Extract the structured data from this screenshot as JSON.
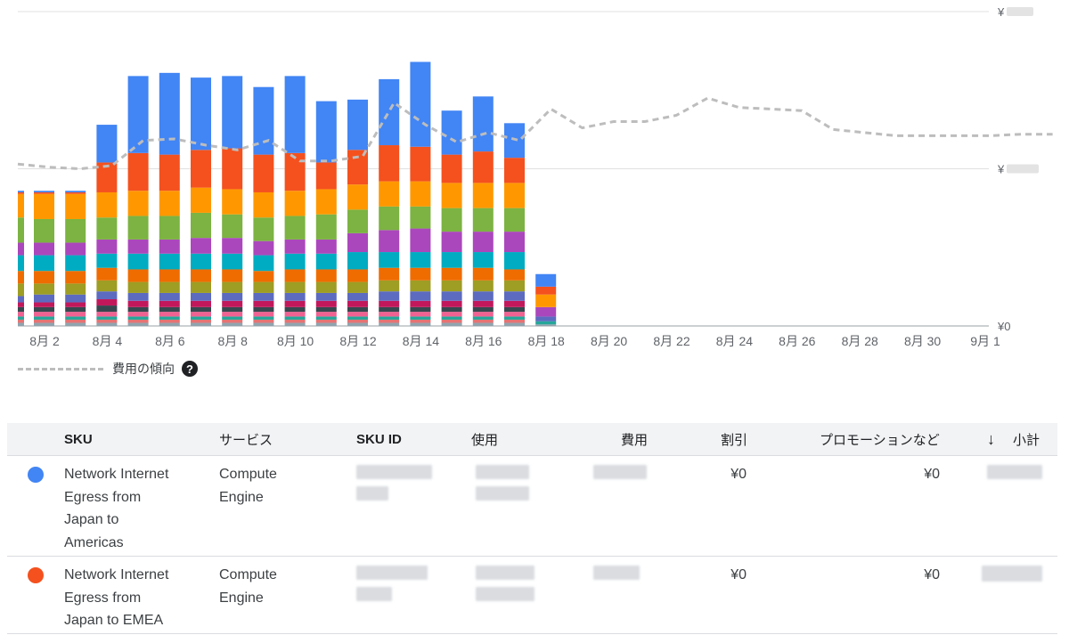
{
  "chart_data": {
    "type": "bar",
    "y_ticks": [
      "¥0"
    ],
    "x_tick_labels": [
      "8月 2",
      "8月 4",
      "8月 6",
      "8月 8",
      "8月 10",
      "8月 12",
      "8月 14",
      "8月 16",
      "8月 18",
      "8月 20",
      "8月 22",
      "8月 24",
      "8月 26",
      "8月 28",
      "8月 30",
      "9月 1"
    ],
    "days": [
      1,
      2,
      3,
      4,
      5,
      6,
      7,
      8,
      9,
      10,
      11,
      12,
      13,
      14,
      15,
      16,
      17,
      18,
      19,
      20,
      21,
      22,
      23,
      24,
      25,
      26,
      27,
      28,
      29,
      30,
      31,
      32
    ],
    "ylim": [
      0,
      200
    ],
    "series": [
      {
        "name": "Network Internet Egress from Japan to Americas",
        "color": "#4285f4",
        "values": [
          1,
          1,
          1,
          24,
          49,
          52,
          46,
          46,
          43,
          49,
          39,
          32,
          42,
          54,
          28,
          35,
          22,
          8
        ]
      },
      {
        "name": "Network Internet Egress from Japan to EMEA",
        "color": "#f4511e",
        "values": [
          1,
          1,
          1,
          19,
          24,
          23,
          24,
          26,
          24,
          24,
          17,
          22,
          23,
          22,
          18,
          20,
          16,
          5
        ]
      },
      {
        "color": "#ff9800",
        "values": [
          15,
          16,
          16,
          16,
          16,
          16,
          16,
          16,
          16,
          16,
          16,
          16,
          16,
          16,
          16,
          16,
          16,
          8
        ]
      },
      {
        "color": "#7cb342",
        "values": [
          16,
          15,
          15,
          14,
          15,
          15,
          16,
          15,
          15,
          15,
          16,
          15,
          15,
          14,
          15,
          15,
          15,
          0
        ]
      },
      {
        "color": "#ab47bc",
        "values": [
          8,
          8,
          8,
          9,
          9,
          9,
          10,
          10,
          9,
          9,
          9,
          12,
          14,
          15,
          13,
          13,
          13,
          6
        ]
      },
      {
        "color": "#00acc1",
        "values": [
          10,
          10,
          10,
          9,
          10,
          10,
          10,
          10,
          10,
          10,
          10,
          11,
          10,
          10,
          10,
          10,
          11,
          0
        ]
      },
      {
        "color": "#ef6c00",
        "values": [
          8,
          8,
          8,
          8,
          8,
          8,
          8,
          8,
          7,
          8,
          8,
          8,
          8,
          8,
          8,
          8,
          7,
          0
        ]
      },
      {
        "color": "#9e9d24",
        "values": [
          8,
          7,
          7,
          7,
          7,
          7,
          7,
          7,
          7,
          7,
          7,
          7,
          7,
          7,
          7,
          7,
          7,
          0
        ]
      },
      {
        "color": "#5c6bc0",
        "values": [
          4,
          5,
          5,
          5,
          5,
          5,
          5,
          5,
          5,
          5,
          5,
          5,
          6,
          6,
          6,
          6,
          6,
          3
        ]
      },
      {
        "color": "#c2185b",
        "values": [
          3,
          3,
          3,
          4,
          4,
          4,
          4,
          4,
          4,
          4,
          4,
          4,
          4,
          4,
          4,
          4,
          4,
          0
        ]
      },
      {
        "color": "#37474f",
        "values": [
          3,
          3,
          3,
          4,
          3,
          3,
          3,
          3,
          3,
          3,
          3,
          3,
          3,
          3,
          3,
          3,
          3,
          0
        ]
      },
      {
        "color": "#f06292",
        "values": [
          3,
          3,
          3,
          3,
          3,
          3,
          3,
          3,
          3,
          3,
          3,
          3,
          3,
          3,
          3,
          3,
          3,
          0
        ]
      },
      {
        "color": "#26a69a",
        "values": [
          2,
          2,
          2,
          2,
          2,
          2,
          2,
          2,
          2,
          2,
          2,
          2,
          2,
          2,
          2,
          2,
          2,
          2
        ]
      },
      {
        "color": "#e57373",
        "values": [
          2,
          2,
          2,
          2,
          2,
          2,
          2,
          2,
          2,
          2,
          2,
          2,
          2,
          2,
          2,
          2,
          2,
          0
        ]
      },
      {
        "color": "#90a4ae",
        "values": [
          2,
          2,
          2,
          2,
          2,
          2,
          2,
          2,
          2,
          2,
          2,
          2,
          2,
          2,
          2,
          2,
          2,
          1
        ]
      }
    ],
    "trend": {
      "name": "費用の傾向",
      "color": "#bdbdbd",
      "values": [
        103,
        101,
        100,
        102,
        118,
        119,
        115,
        112,
        118,
        105,
        105,
        108,
        142,
        128,
        117,
        123,
        118,
        138,
        126,
        130,
        130,
        134,
        145,
        139,
        138,
        137,
        125,
        123,
        121,
        121,
        121,
        121,
        122,
        122
      ]
    },
    "grid": true
  },
  "legend": {
    "trend_label": "費用の傾向",
    "help_icon": "help-circle-icon"
  },
  "table": {
    "headers": {
      "sku": "SKU",
      "service": "サービス",
      "sku_id": "SKU ID",
      "usage": "使用",
      "cost": "費用",
      "discount": "割引",
      "promo": "プロモーションなど",
      "subtotal": "小計",
      "sort_icon": "arrow-down-icon"
    },
    "rows": [
      {
        "color": "#4285f4",
        "sku_lines": [
          "Network Internet",
          "Egress from",
          "Japan to",
          "Americas"
        ],
        "service_lines": [
          "Compute",
          "Engine"
        ],
        "discount": "¥0",
        "promo": "¥0"
      },
      {
        "color": "#f4511e",
        "sku_lines": [
          "Network Internet",
          "Egress from",
          "Japan to EMEA"
        ],
        "service_lines": [
          "Compute",
          "Engine"
        ],
        "discount": "¥0",
        "promo": "¥0"
      }
    ]
  }
}
